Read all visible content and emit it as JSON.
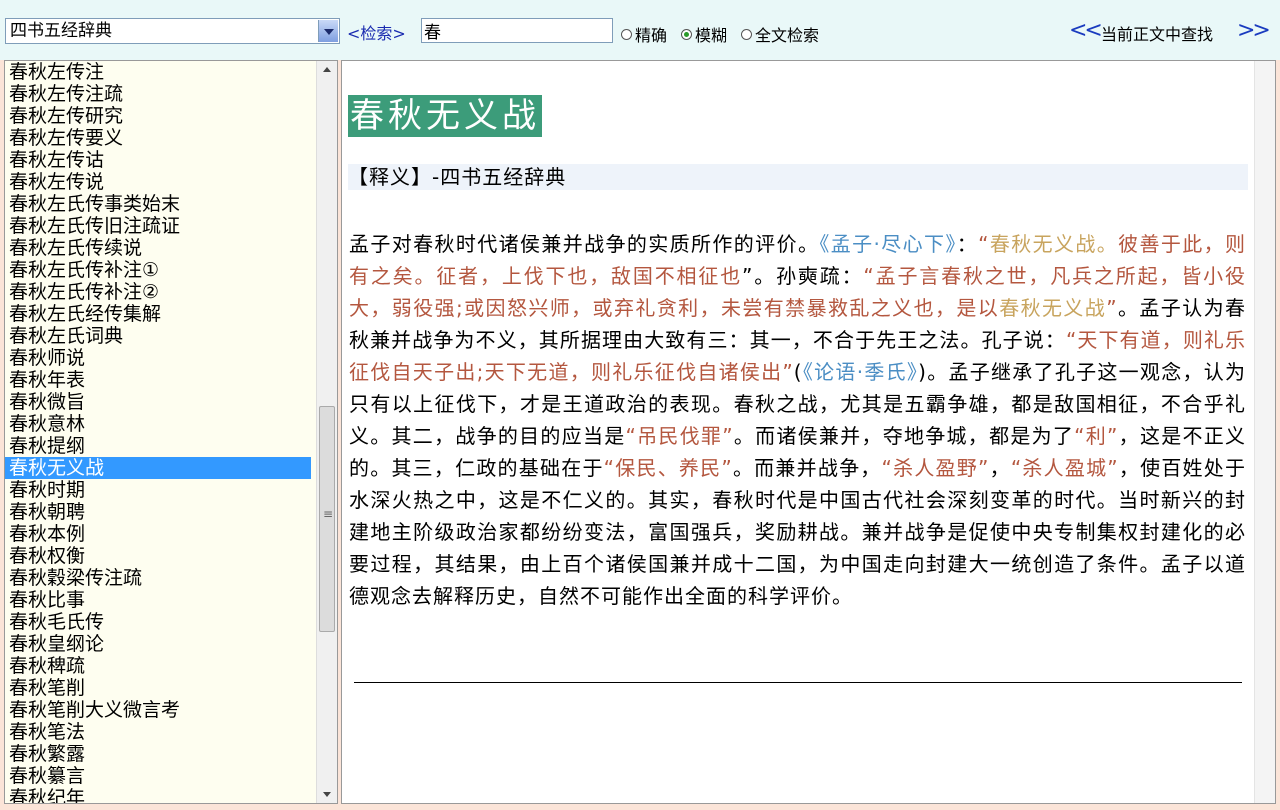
{
  "toolbar": {
    "dictionary_selected": "四书五经辞典",
    "search_label": "<检索>",
    "search_value": "春",
    "radio_exact": "精确",
    "radio_fuzzy": "模糊",
    "radio_fulltext": "全文检索",
    "selected_mode": "模糊",
    "prev_label": "<<",
    "find_in_text_label": "当前正文中查找",
    "next_label": ">>"
  },
  "sidebar": {
    "items": [
      "春秋左传注",
      "春秋左传注疏",
      "春秋左传研究",
      "春秋左传要义",
      "春秋左传诂",
      "春秋左传说",
      "春秋左氏传事类始末",
      "春秋左氏传旧注疏证",
      "春秋左氏传续说",
      "春秋左氏传补注①",
      "春秋左氏传补注②",
      "春秋左氏经传集解",
      "春秋左氏词典",
      "春秋师说",
      "春秋年表",
      "春秋微旨",
      "春秋意林",
      "春秋提纲",
      "春秋无义战",
      "春秋时期",
      "春秋朝聘",
      "春秋本例",
      "春秋权衡",
      "春秋穀梁传注疏",
      "春秋比事",
      "春秋毛氏传",
      "春秋皇纲论",
      "春秋稗疏",
      "春秋笔削",
      "春秋笔削大义微言考",
      "春秋笔法",
      "春秋繁露",
      "春秋纂言",
      "春秋纪年"
    ],
    "selected": "春秋无义战"
  },
  "content": {
    "title": "春秋无义战",
    "definition_header": "【释义】-四书五经辞典",
    "segments": [
      {
        "t": "孟子对春秋时代诸侯兼并战争的实质所作的评价。",
        "c": ""
      },
      {
        "t": "《孟子·尽心下》",
        "c": "blu"
      },
      {
        "t": "：",
        "c": ""
      },
      {
        "t": "“",
        "c": "q"
      },
      {
        "t": "春秋无义战。",
        "c": "yel"
      },
      {
        "t": "彼善于此，则有之矣。征者，上伐下也，敌国不相征也",
        "c": "q"
      },
      {
        "t": "”。孙奭疏：",
        "c": ""
      },
      {
        "t": "“孟子言春秋之世，凡兵之所起，皆小役大，弱役强;或因怒兴师，或弃礼贪利，未尝有禁暴救乱之义也，是以",
        "c": "q"
      },
      {
        "t": "春秋无义战",
        "c": "yel"
      },
      {
        "t": "”",
        "c": "q"
      },
      {
        "t": "。孟子认为春秋兼并战争为不义，其所据理由大致有三：其一，不合于先王之法。孔子说：",
        "c": ""
      },
      {
        "t": "“天下有道，则礼乐征伐自天子出;天下无道，则礼乐征伐自诸侯出”",
        "c": "q"
      },
      {
        "t": "(",
        "c": ""
      },
      {
        "t": "《论语·季氏》",
        "c": "blu"
      },
      {
        "t": ")。孟子继承了孔子这一观念，认为只有以上征伐下，才是王道政治的表现。春秋之战，尤其是五霸争雄，都是敌国相征，不合乎礼义。其二，战争的目的应当是",
        "c": ""
      },
      {
        "t": "“吊民伐罪”",
        "c": "q"
      },
      {
        "t": "。而诸侯兼并，夺地争城，都是为了",
        "c": ""
      },
      {
        "t": "“利”",
        "c": "q"
      },
      {
        "t": "，这是不正义的。其三，仁政的基础在于",
        "c": ""
      },
      {
        "t": "“保民、养民”",
        "c": "q"
      },
      {
        "t": "。而兼并战争，",
        "c": ""
      },
      {
        "t": "“杀人盈野”",
        "c": "q"
      },
      {
        "t": "，",
        "c": ""
      },
      {
        "t": "“杀人盈城”",
        "c": "q"
      },
      {
        "t": "，使百姓处于水深火热之中，这是不仁义的。其实，春秋时代是中国古代社会深刻变革的时代。当时新兴的封建地主阶级政治家都纷纷变法，富国强兵，奖励耕战。兼并战争是促使中央专制集权封建化的必要过程，其结果，由上百个诸侯国兼并成十二国，为中国走向封建大一统创造了条件。孟子以道德观念去解释历史，自然不可能作出全面的科学评价。",
        "c": ""
      }
    ]
  },
  "colors": {
    "title_bg": "#3c9c7a",
    "quote": "#b4573f",
    "highlight": "#c8a45e",
    "reference": "#4b8ec4",
    "selection": "#3399ff"
  }
}
